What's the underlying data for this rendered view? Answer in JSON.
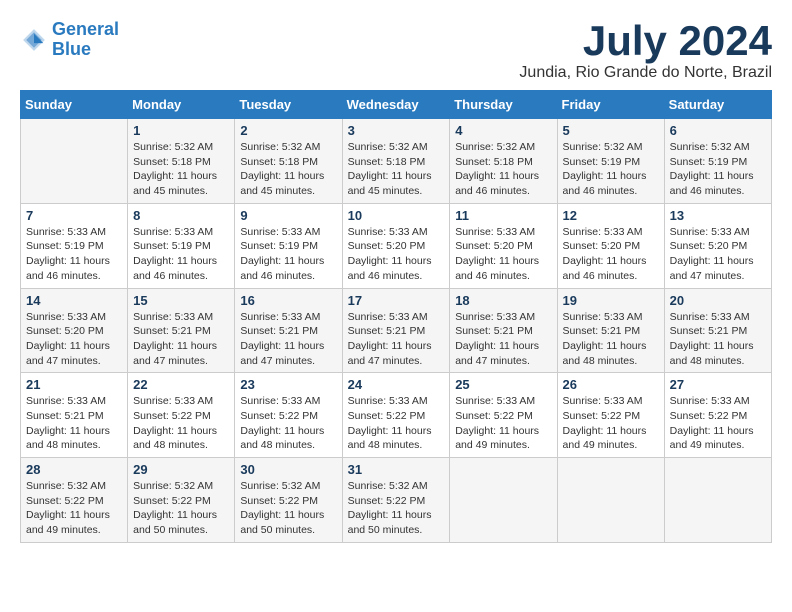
{
  "header": {
    "logo_line1": "General",
    "logo_line2": "Blue",
    "month": "July 2024",
    "location": "Jundia, Rio Grande do Norte, Brazil"
  },
  "weekdays": [
    "Sunday",
    "Monday",
    "Tuesday",
    "Wednesday",
    "Thursday",
    "Friday",
    "Saturday"
  ],
  "weeks": [
    [
      {
        "day": "",
        "info": ""
      },
      {
        "day": "1",
        "info": "Sunrise: 5:32 AM\nSunset: 5:18 PM\nDaylight: 11 hours\nand 45 minutes."
      },
      {
        "day": "2",
        "info": "Sunrise: 5:32 AM\nSunset: 5:18 PM\nDaylight: 11 hours\nand 45 minutes."
      },
      {
        "day": "3",
        "info": "Sunrise: 5:32 AM\nSunset: 5:18 PM\nDaylight: 11 hours\nand 45 minutes."
      },
      {
        "day": "4",
        "info": "Sunrise: 5:32 AM\nSunset: 5:18 PM\nDaylight: 11 hours\nand 46 minutes."
      },
      {
        "day": "5",
        "info": "Sunrise: 5:32 AM\nSunset: 5:19 PM\nDaylight: 11 hours\nand 46 minutes."
      },
      {
        "day": "6",
        "info": "Sunrise: 5:32 AM\nSunset: 5:19 PM\nDaylight: 11 hours\nand 46 minutes."
      }
    ],
    [
      {
        "day": "7",
        "info": "Sunrise: 5:33 AM\nSunset: 5:19 PM\nDaylight: 11 hours\nand 46 minutes."
      },
      {
        "day": "8",
        "info": "Sunrise: 5:33 AM\nSunset: 5:19 PM\nDaylight: 11 hours\nand 46 minutes."
      },
      {
        "day": "9",
        "info": "Sunrise: 5:33 AM\nSunset: 5:19 PM\nDaylight: 11 hours\nand 46 minutes."
      },
      {
        "day": "10",
        "info": "Sunrise: 5:33 AM\nSunset: 5:20 PM\nDaylight: 11 hours\nand 46 minutes."
      },
      {
        "day": "11",
        "info": "Sunrise: 5:33 AM\nSunset: 5:20 PM\nDaylight: 11 hours\nand 46 minutes."
      },
      {
        "day": "12",
        "info": "Sunrise: 5:33 AM\nSunset: 5:20 PM\nDaylight: 11 hours\nand 46 minutes."
      },
      {
        "day": "13",
        "info": "Sunrise: 5:33 AM\nSunset: 5:20 PM\nDaylight: 11 hours\nand 47 minutes."
      }
    ],
    [
      {
        "day": "14",
        "info": "Sunrise: 5:33 AM\nSunset: 5:20 PM\nDaylight: 11 hours\nand 47 minutes."
      },
      {
        "day": "15",
        "info": "Sunrise: 5:33 AM\nSunset: 5:21 PM\nDaylight: 11 hours\nand 47 minutes."
      },
      {
        "day": "16",
        "info": "Sunrise: 5:33 AM\nSunset: 5:21 PM\nDaylight: 11 hours\nand 47 minutes."
      },
      {
        "day": "17",
        "info": "Sunrise: 5:33 AM\nSunset: 5:21 PM\nDaylight: 11 hours\nand 47 minutes."
      },
      {
        "day": "18",
        "info": "Sunrise: 5:33 AM\nSunset: 5:21 PM\nDaylight: 11 hours\nand 47 minutes."
      },
      {
        "day": "19",
        "info": "Sunrise: 5:33 AM\nSunset: 5:21 PM\nDaylight: 11 hours\nand 48 minutes."
      },
      {
        "day": "20",
        "info": "Sunrise: 5:33 AM\nSunset: 5:21 PM\nDaylight: 11 hours\nand 48 minutes."
      }
    ],
    [
      {
        "day": "21",
        "info": "Sunrise: 5:33 AM\nSunset: 5:21 PM\nDaylight: 11 hours\nand 48 minutes."
      },
      {
        "day": "22",
        "info": "Sunrise: 5:33 AM\nSunset: 5:22 PM\nDaylight: 11 hours\nand 48 minutes."
      },
      {
        "day": "23",
        "info": "Sunrise: 5:33 AM\nSunset: 5:22 PM\nDaylight: 11 hours\nand 48 minutes."
      },
      {
        "day": "24",
        "info": "Sunrise: 5:33 AM\nSunset: 5:22 PM\nDaylight: 11 hours\nand 48 minutes."
      },
      {
        "day": "25",
        "info": "Sunrise: 5:33 AM\nSunset: 5:22 PM\nDaylight: 11 hours\nand 49 minutes."
      },
      {
        "day": "26",
        "info": "Sunrise: 5:33 AM\nSunset: 5:22 PM\nDaylight: 11 hours\nand 49 minutes."
      },
      {
        "day": "27",
        "info": "Sunrise: 5:33 AM\nSunset: 5:22 PM\nDaylight: 11 hours\nand 49 minutes."
      }
    ],
    [
      {
        "day": "28",
        "info": "Sunrise: 5:32 AM\nSunset: 5:22 PM\nDaylight: 11 hours\nand 49 minutes."
      },
      {
        "day": "29",
        "info": "Sunrise: 5:32 AM\nSunset: 5:22 PM\nDaylight: 11 hours\nand 50 minutes."
      },
      {
        "day": "30",
        "info": "Sunrise: 5:32 AM\nSunset: 5:22 PM\nDaylight: 11 hours\nand 50 minutes."
      },
      {
        "day": "31",
        "info": "Sunrise: 5:32 AM\nSunset: 5:22 PM\nDaylight: 11 hours\nand 50 minutes."
      },
      {
        "day": "",
        "info": ""
      },
      {
        "day": "",
        "info": ""
      },
      {
        "day": "",
        "info": ""
      }
    ]
  ]
}
